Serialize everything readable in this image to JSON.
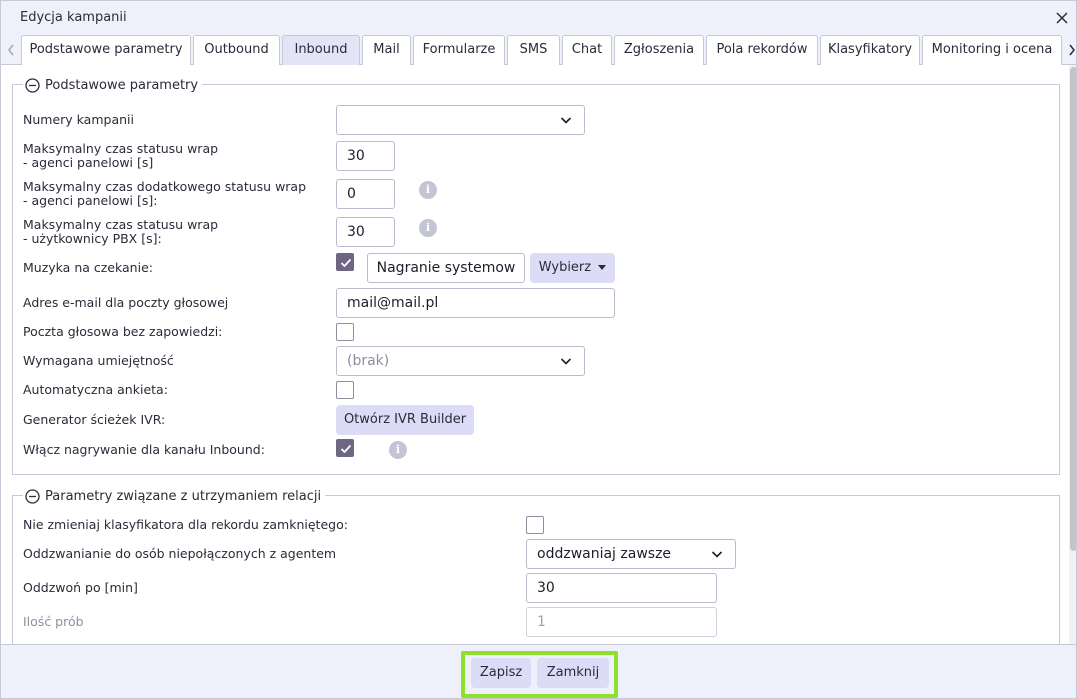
{
  "dialog": {
    "title": "Edycja kampanii",
    "close_glyph": "✕"
  },
  "tabs": [
    {
      "label": "Podstawowe parametry",
      "active": false
    },
    {
      "label": "Outbound",
      "active": false
    },
    {
      "label": "Inbound",
      "active": true
    },
    {
      "label": "Mail",
      "active": false
    },
    {
      "label": "Formularze",
      "active": false
    },
    {
      "label": "SMS",
      "active": false
    },
    {
      "label": "Chat",
      "active": false
    },
    {
      "label": "Zgłoszenia",
      "active": false
    },
    {
      "label": "Pola rekordów",
      "active": false
    },
    {
      "label": "Klasyfikatory",
      "active": false
    },
    {
      "label": "Monitoring i ocena",
      "active": false
    }
  ],
  "section_basic": {
    "title": "Podstawowe parametry",
    "campaign_numbers": {
      "label": "Numery kampanii",
      "value": ""
    },
    "wrap_panel": {
      "label_line1": "Maksymalny czas statusu wrap",
      "label_line2": "- agenci panelowi [s]",
      "value": "30"
    },
    "wrap_extra": {
      "label_line1": "Maksymalny czas dodatkowego statusu wrap",
      "label_line2": "- agenci panelowi [s]:",
      "value": "0"
    },
    "wrap_pbx": {
      "label_line1": "Maksymalny czas statusu wrap",
      "label_line2": "- użytkownicy PBX [s]:",
      "value": "30"
    },
    "hold_music": {
      "label": "Muzyka na czekanie:",
      "checked": true,
      "recording": "Nagranie systemow",
      "choose_label": "Wybierz"
    },
    "voicemail_email": {
      "label": "Adres e-mail dla poczty głosowej",
      "value": "mail@mail.pl"
    },
    "voicemail_no_prompt": {
      "label": "Poczta głosowa bez zapowiedzi:",
      "checked": false
    },
    "required_skill": {
      "label": "Wymagana umiejętność",
      "value": "(brak)"
    },
    "auto_survey": {
      "label": "Automatyczna ankieta:",
      "checked": false
    },
    "ivr_generator": {
      "label": "Generator ścieżek IVR:",
      "button": "Otwórz IVR Builder"
    },
    "inbound_recording": {
      "label": "Włącz nagrywanie dla kanału Inbound:",
      "checked": true
    }
  },
  "section_relations": {
    "title": "Parametry związane z utrzymaniem relacji",
    "keep_classifier": {
      "label": "Nie zmieniaj klasyfikatora dla rekordu zamkniętego:",
      "checked": false
    },
    "callback_mode": {
      "label": "Oddzwanianie do osób niepołączonych z agentem",
      "value": "oddzwaniaj zawsze"
    },
    "callback_after": {
      "label": "Oddzwoń po [min]",
      "value": "30"
    },
    "attempts": {
      "label": "Ilość prób",
      "value": "1"
    }
  },
  "footer": {
    "save_label": "Zapisz",
    "close_label": "Zamknij",
    "highlight_color": "#8ee02a"
  },
  "colors": {
    "accent_button": "#dcdcf7",
    "checkbox_checked": "#6e6784",
    "header_bg": "#eef0fa"
  }
}
